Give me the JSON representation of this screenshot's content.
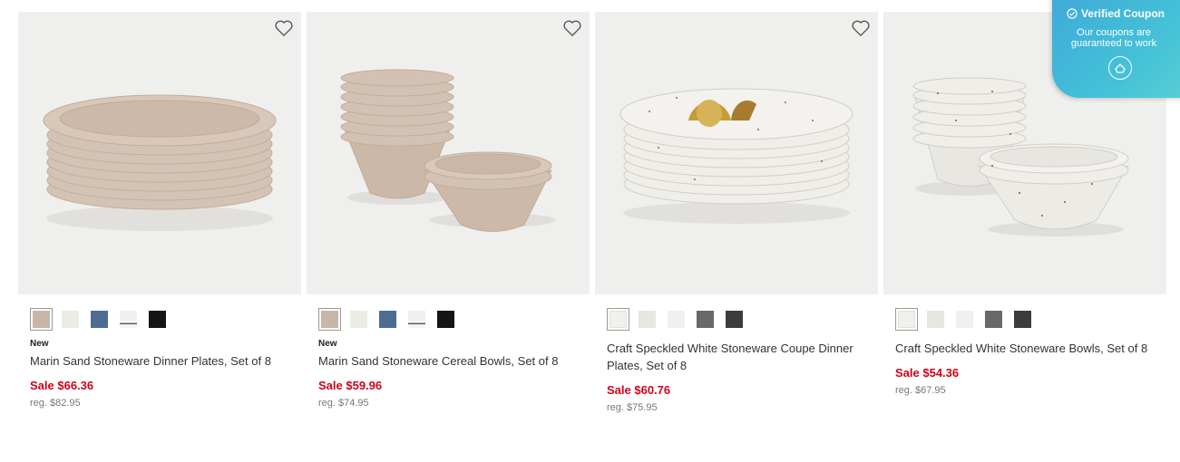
{
  "products": [
    {
      "badge": "New",
      "title": "Marin Sand Stoneware Dinner Plates, Set of 8",
      "sale_price": "Sale $66.36",
      "reg_price": "reg. $82.95",
      "swatches": [
        "#c9b6a8",
        "#ecebe4",
        "#4d6c92",
        "#f2f4f6",
        "#151515"
      ],
      "selected_swatch": 0
    },
    {
      "badge": "New",
      "title": "Marin Sand Stoneware Cereal Bowls, Set of 8",
      "sale_price": "Sale $59.96",
      "reg_price": "reg. $74.95",
      "swatches": [
        "#c9b6a8",
        "#ecebe4",
        "#4d6c92",
        "#f2f4f6",
        "#151515"
      ],
      "selected_swatch": 0
    },
    {
      "badge": "",
      "title": "Craft Speckled White Stoneware Coupe Dinner Plates, Set of 8",
      "sale_price": "Sale $60.76",
      "reg_price": "reg. $75.95",
      "swatches": [
        "#f1f0ec",
        "#e8e6e0",
        "#f0f0f0",
        "#6b6866",
        "#3c3c3c"
      ],
      "selected_swatch": 0
    },
    {
      "badge": "",
      "title": "Craft Speckled White Stoneware Bowls, Set of 8",
      "sale_price": "Sale $54.36",
      "reg_price": "reg. $67.95",
      "swatches": [
        "#f1f0ec",
        "#e8e6e0",
        "#f0f0f0",
        "#6b6866",
        "#3c3c3c"
      ],
      "selected_swatch": 0
    }
  ],
  "coupon": {
    "title": "Verified Coupon",
    "subtitle_line1": "Our coupons are",
    "subtitle_line2": "guaranteed to work"
  },
  "colors": {
    "sale": "#d0021b",
    "coupon_gradient_start": "#3fa9d8",
    "coupon_gradient_end": "#5bd0d2"
  },
  "icons": {
    "favorite": "heart-outline-icon",
    "coupon_check": "check-circle-icon",
    "coupon_logo": "coupon-logo-icon"
  }
}
